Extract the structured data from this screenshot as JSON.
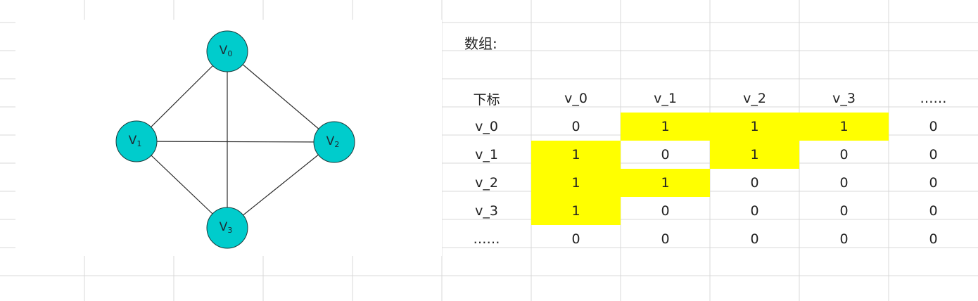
{
  "array_title": "数组:",
  "graph": {
    "vertices": [
      {
        "name": "V",
        "sub": "0"
      },
      {
        "name": "V",
        "sub": "1"
      },
      {
        "name": "V",
        "sub": "2"
      },
      {
        "name": "V",
        "sub": "3"
      }
    ],
    "edges": [
      [
        0,
        1
      ],
      [
        0,
        2
      ],
      [
        0,
        3
      ],
      [
        1,
        2
      ],
      [
        1,
        3
      ],
      [
        2,
        3
      ]
    ],
    "vertex_color": "#00cccc",
    "edge_color": "#2b2b2b"
  },
  "table": {
    "corner": "下标",
    "col_headers": [
      "v_0",
      "v_1",
      "v_2",
      "v_3",
      "……"
    ],
    "row_headers": [
      "v_0",
      "v_1",
      "v_2",
      "v_3",
      "……"
    ],
    "values": [
      [
        "0",
        "1",
        "1",
        "1",
        "0"
      ],
      [
        "1",
        "0",
        "1",
        "0",
        "0"
      ],
      [
        "1",
        "1",
        "0",
        "0",
        "0"
      ],
      [
        "1",
        "0",
        "0",
        "0",
        "0"
      ],
      [
        "0",
        "0",
        "0",
        "0",
        "0"
      ]
    ],
    "highlighted": [
      [
        0,
        1
      ],
      [
        0,
        2
      ],
      [
        0,
        3
      ],
      [
        1,
        0
      ],
      [
        1,
        2
      ],
      [
        2,
        0
      ],
      [
        2,
        1
      ],
      [
        3,
        0
      ]
    ],
    "highlight_color": "#ffff00"
  }
}
